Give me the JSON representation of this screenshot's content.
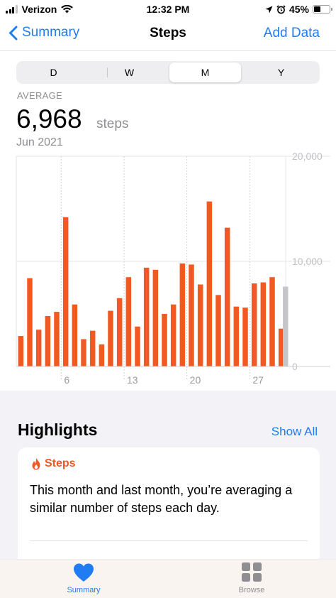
{
  "status_bar": {
    "carrier": "Verizon",
    "time": "12:32 PM",
    "battery_percent": "45%",
    "battery_level": 0.45,
    "signal_bars_on": 3,
    "signal_bars_total": 4
  },
  "nav": {
    "back_label": "Summary",
    "title": "Steps",
    "action_label": "Add Data"
  },
  "segments": {
    "items": [
      "D",
      "W",
      "M",
      "Y"
    ],
    "selected": "M"
  },
  "summary": {
    "label": "AVERAGE",
    "value": "6,968",
    "unit": "steps",
    "period": "Jun 2021"
  },
  "chart_data": {
    "type": "bar",
    "x": [
      1,
      2,
      3,
      4,
      5,
      6,
      7,
      8,
      9,
      10,
      11,
      12,
      13,
      14,
      15,
      16,
      17,
      18,
      19,
      20,
      21,
      22,
      23,
      24,
      25,
      26,
      27,
      28,
      29,
      30
    ],
    "values": [
      2900,
      8400,
      3500,
      4800,
      5200,
      14200,
      5900,
      2600,
      3400,
      2100,
      5300,
      6500,
      8500,
      3800,
      9400,
      9200,
      5000,
      5900,
      9800,
      9700,
      7800,
      15700,
      6800,
      13200,
      5700,
      5600,
      7900,
      8000,
      8500,
      3600
    ],
    "highlighted_last": {
      "x": 30,
      "value": 7600,
      "color": "#c6c6c8"
    },
    "bar_color": "#f05a22",
    "xtick_labels": [
      "6",
      "13",
      "20",
      "27"
    ],
    "xtick_values": [
      6,
      13,
      20,
      27
    ],
    "ytick_labels": [
      "20,000",
      "10,000",
      "0"
    ],
    "ytick_values": [
      20000,
      10000,
      0
    ],
    "ylim": [
      0,
      20000
    ],
    "grid": true
  },
  "highlights": {
    "title": "Highlights",
    "show_all_label": "Show All",
    "card": {
      "icon": "flame-icon",
      "heading": "Steps",
      "text": "This month and last month, you’re averaging a similar number of steps each day."
    }
  },
  "tabbar": {
    "items": [
      {
        "label": "Summary",
        "icon": "heart-icon",
        "active": true
      },
      {
        "label": "Browse",
        "icon": "grid-icon",
        "active": false
      }
    ]
  },
  "colors": {
    "accent": "#1f7cf3",
    "steps_orange": "#f05a22",
    "secondary_text": "#8e8e93"
  }
}
